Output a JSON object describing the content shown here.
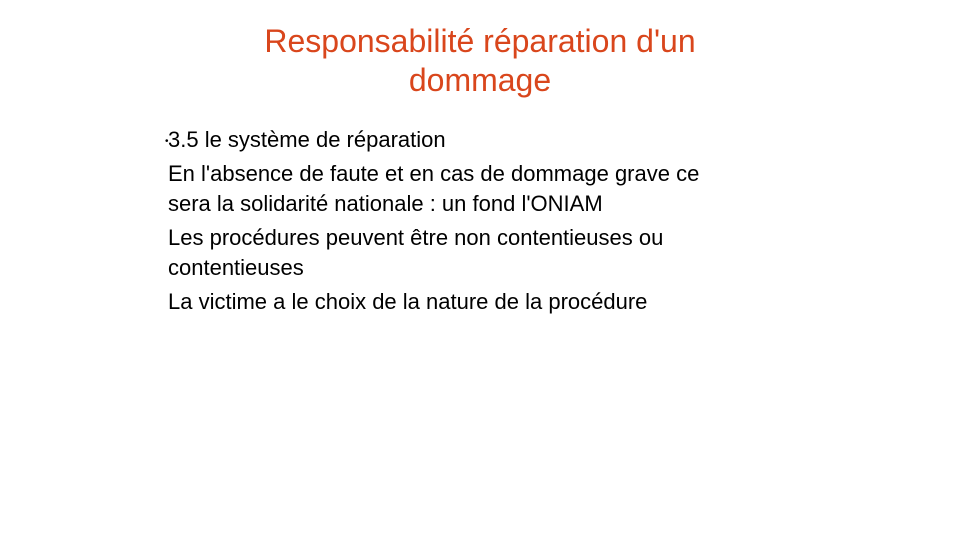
{
  "slide": {
    "title_line1": "Responsabilité réparation d'un",
    "title_line2": "dommage",
    "bullet_glyph": "•",
    "items": [
      {
        "lines": [
          "3.5 le système de réparation"
        ]
      },
      {
        "lines": [
          "En l'absence de faute et en cas de dommage grave ce",
          "sera la solidarité nationale : un fond l'ONIAM"
        ]
      },
      {
        "lines": [
          "Les procédures peuvent être non contentieuses ou",
          "contentieuses"
        ]
      },
      {
        "lines": [
          "La victime a le choix de la nature de la procédure"
        ]
      }
    ]
  },
  "colors": {
    "title": "#d9461c",
    "text": "#000000",
    "background": "#ffffff"
  }
}
